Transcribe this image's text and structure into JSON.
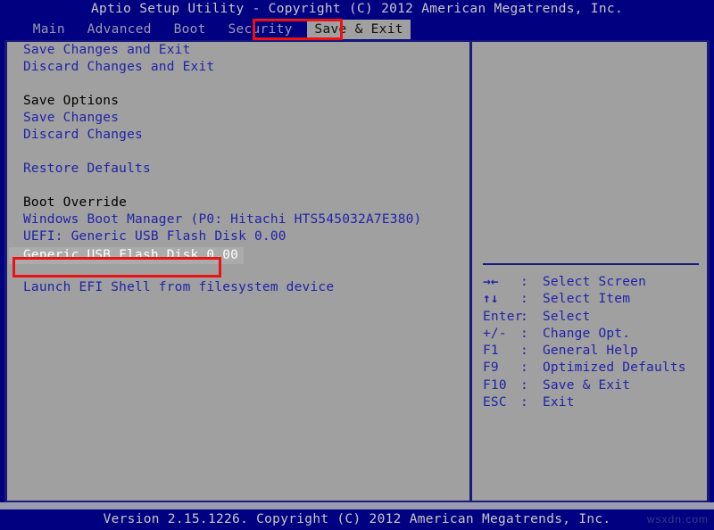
{
  "title": "Aptio Setup Utility - Copyright (C) 2012 American Megatrends, Inc.",
  "menu": {
    "items": [
      {
        "label": "Main",
        "active": false
      },
      {
        "label": "Advanced",
        "active": false
      },
      {
        "label": "Boot",
        "active": false
      },
      {
        "label": "Security",
        "active": false
      },
      {
        "label": "Save & Exit",
        "active": true
      }
    ]
  },
  "main": {
    "rows": [
      {
        "text": "Save Changes and Exit",
        "kind": "link"
      },
      {
        "text": "Discard Changes and Exit",
        "kind": "link"
      },
      {
        "text": "",
        "kind": "spacer"
      },
      {
        "text": "Save Options",
        "kind": "header"
      },
      {
        "text": "Save Changes",
        "kind": "link"
      },
      {
        "text": "Discard Changes",
        "kind": "link"
      },
      {
        "text": "",
        "kind": "spacer"
      },
      {
        "text": "Restore Defaults",
        "kind": "link"
      },
      {
        "text": "",
        "kind": "spacer"
      },
      {
        "text": "Boot Override",
        "kind": "header"
      },
      {
        "text": "Windows Boot Manager (P0: Hitachi HTS545032A7E380)",
        "kind": "link"
      },
      {
        "text": "UEFI: Generic USB Flash Disk 0.00",
        "kind": "link"
      },
      {
        "text": "Generic USB Flash Disk 0.00",
        "kind": "selected"
      },
      {
        "text": "",
        "kind": "spacer"
      },
      {
        "text": "Launch EFI Shell from filesystem device",
        "kind": "link"
      }
    ]
  },
  "help": {
    "keys": [
      {
        "key": "→←",
        "sep": ":",
        "desc": "Select Screen",
        "bold": true
      },
      {
        "key": "↑↓",
        "sep": ":",
        "desc": "Select Item",
        "bold": true
      },
      {
        "key": "Enter",
        "sep": ":",
        "desc": "Select",
        "bold": false
      },
      {
        "key": "+/-",
        "sep": ":",
        "desc": "Change Opt.",
        "bold": false
      },
      {
        "key": "F1",
        "sep": ":",
        "desc": "General Help",
        "bold": false
      },
      {
        "key": "F9",
        "sep": ":",
        "desc": "Optimized Defaults",
        "bold": false
      },
      {
        "key": "F10",
        "sep": ":",
        "desc": "Save & Exit",
        "bold": false
      },
      {
        "key": "ESC",
        "sep": ":",
        "desc": "Exit",
        "bold": false
      }
    ]
  },
  "footer": {
    "version": "Version 2.15.1226. Copyright (C) 2012 American Megatrends, Inc.",
    "watermark": "wsxdn.com"
  },
  "colors": {
    "screen_blue": "#000080",
    "panel_grey": "#a0a0a0",
    "link_blue": "#2222a8",
    "header_black": "#000000",
    "annotation_red": "#ee1111",
    "border_blue": "#1a1a7a"
  }
}
